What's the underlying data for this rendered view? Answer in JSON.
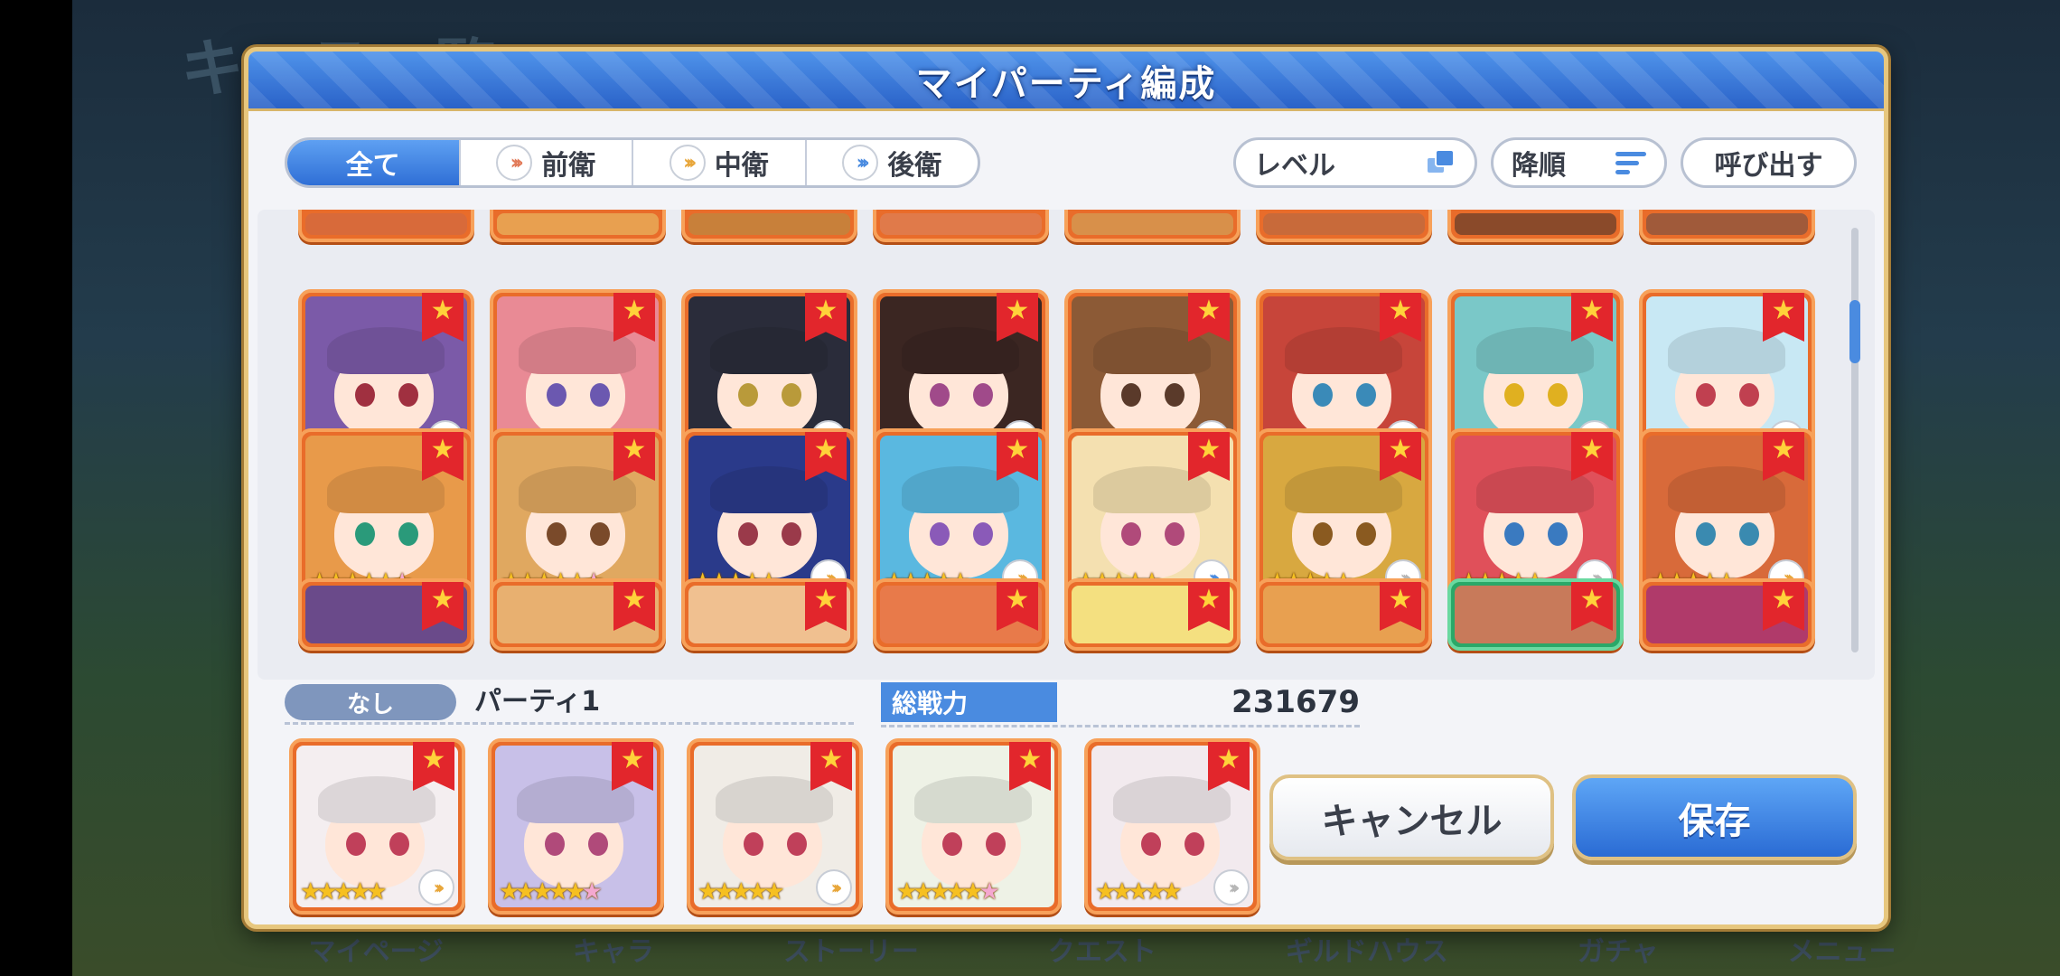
{
  "background": {
    "page_title_fragment": "キャラ一覧",
    "nav": [
      "マイページ",
      "キャラ",
      "ストーリー",
      "クエスト",
      "ギルドハウス",
      "ガチャ",
      "メニュー"
    ]
  },
  "dialog": {
    "title": "マイパーティ編成",
    "tabs": [
      {
        "label": "全て",
        "role": "all",
        "active": true
      },
      {
        "label": "前衛",
        "role": "front",
        "active": false
      },
      {
        "label": "中衛",
        "role": "mid",
        "active": false
      },
      {
        "label": "後衛",
        "role": "back",
        "active": false
      }
    ],
    "sort_key_label": "レベル",
    "sort_order_label": "降順",
    "recall_label": "呼び出す",
    "roster_rows": [
      [
        {
          "hair": "#7b5aa8",
          "eye": "#a03040",
          "stars": 5,
          "six": false,
          "role": "front"
        },
        {
          "hair": "#e98a95",
          "eye": "#6b58b0",
          "stars": 5,
          "six": false,
          "role": "none"
        },
        {
          "hair": "#2a2c3a",
          "eye": "#b99a3a",
          "stars": 5,
          "six": false,
          "role": "back"
        },
        {
          "hair": "#3b2622",
          "eye": "#a04a8a",
          "stars": 5,
          "six": false,
          "role": "mid"
        },
        {
          "hair": "#8c5a36",
          "eye": "#5a3a2a",
          "stars": 5,
          "six": false,
          "role": "mid"
        },
        {
          "hair": "#c7453a",
          "eye": "#3a8ab8",
          "stars": 5,
          "six": false,
          "role": "back"
        },
        {
          "hair": "#7ac8c8",
          "eye": "#e0b020",
          "stars": 5,
          "six": false,
          "role": "front"
        },
        {
          "hair": "#c8e8f4",
          "eye": "#c04050",
          "stars": 5,
          "six": false,
          "role": "front"
        }
      ],
      [
        {
          "hair": "#e89a4a",
          "eye": "#2a9a7a",
          "stars": 5,
          "six": true,
          "role": "none"
        },
        {
          "hair": "#e0a860",
          "eye": "#7a4a2a",
          "stars": 5,
          "six": true,
          "role": "none"
        },
        {
          "hair": "#2a3a8a",
          "eye": "#9a3a4a",
          "stars": 5,
          "six": false,
          "role": "mid"
        },
        {
          "hair": "#5ab8e0",
          "eye": "#8a5ab8",
          "stars": 5,
          "six": false,
          "role": "mid"
        },
        {
          "hair": "#f4e0b0",
          "eye": "#b04a7a",
          "stars": 5,
          "six": false,
          "role": "back"
        },
        {
          "hair": "#d8a840",
          "eye": "#8a5a20",
          "stars": 5,
          "six": false,
          "role": "front"
        },
        {
          "hair": "#e0505a",
          "eye": "#3a7ac0",
          "stars": 5,
          "six": false,
          "role": "front"
        },
        {
          "hair": "#d86a3a",
          "eye": "#3a8ab0",
          "stars": 5,
          "six": false,
          "role": "mid"
        }
      ],
      [
        {
          "hair": "#6a4a8a"
        },
        {
          "hair": "#e8b070"
        },
        {
          "hair": "#f0c090"
        },
        {
          "hair": "#e87a4a"
        },
        {
          "hair": "#f4e080"
        },
        {
          "hair": "#e8a050"
        },
        {
          "hair": "#c87a5a",
          "green": true
        },
        {
          "hair": "#b03a6a"
        }
      ]
    ],
    "party_tag": "なし",
    "party_name": "パーティ1",
    "power_label": "総戦力",
    "power_value": "231679",
    "party_members": [
      {
        "hair": "#f4eef0",
        "eye": "#c0405a",
        "stars": 5,
        "six": false,
        "role": "mid"
      },
      {
        "hair": "#c8c0e8",
        "eye": "#b04a7a",
        "stars": 5,
        "six": true,
        "role": "none"
      },
      {
        "hair": "#f0ece6",
        "eye": "#c0405a",
        "stars": 5,
        "six": false,
        "role": "mid"
      },
      {
        "hair": "#eef2e6",
        "eye": "#c0405a",
        "stars": 5,
        "six": true,
        "role": "none"
      },
      {
        "hair": "#f2eaee",
        "eye": "#c0405a",
        "stars": 5,
        "six": false,
        "role": "front"
      }
    ],
    "cancel_label": "キャンセル",
    "save_label": "保存"
  }
}
